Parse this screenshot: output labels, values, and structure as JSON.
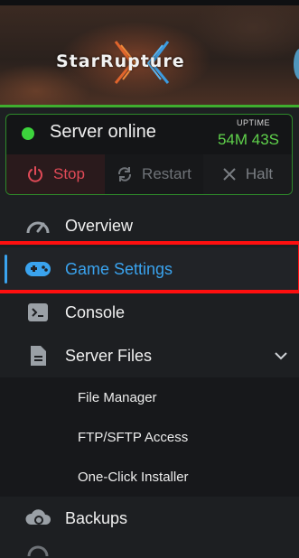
{
  "banner": {
    "logo_text": "StarRupture",
    "accent_color": "#3fae2f"
  },
  "status": {
    "state_label": "Server online",
    "state_color": "#3cd43c",
    "uptime_label": "UPTIME",
    "uptime_value": "54M 43S",
    "actions": [
      {
        "label": "Stop",
        "icon": "power-icon"
      },
      {
        "label": "Restart",
        "icon": "restart-icon"
      },
      {
        "label": "Halt",
        "icon": "close-icon"
      }
    ]
  },
  "nav": {
    "items": [
      {
        "label": "Overview",
        "icon": "gauge-icon"
      },
      {
        "label": "Game Settings",
        "icon": "gamepad-icon",
        "active": true
      },
      {
        "label": "Console",
        "icon": "terminal-icon"
      },
      {
        "label": "Server Files",
        "icon": "file-icon",
        "expanded": true
      },
      {
        "label": "Backups",
        "icon": "backup-icon"
      }
    ],
    "server_files_children": [
      {
        "label": "File Manager"
      },
      {
        "label": "FTP/SFTP Access"
      },
      {
        "label": "One-Click Installer"
      }
    ]
  },
  "colors": {
    "active_accent": "#3aa3ee",
    "stop_color": "#e04a57",
    "highlight": "#ff0f0f"
  }
}
